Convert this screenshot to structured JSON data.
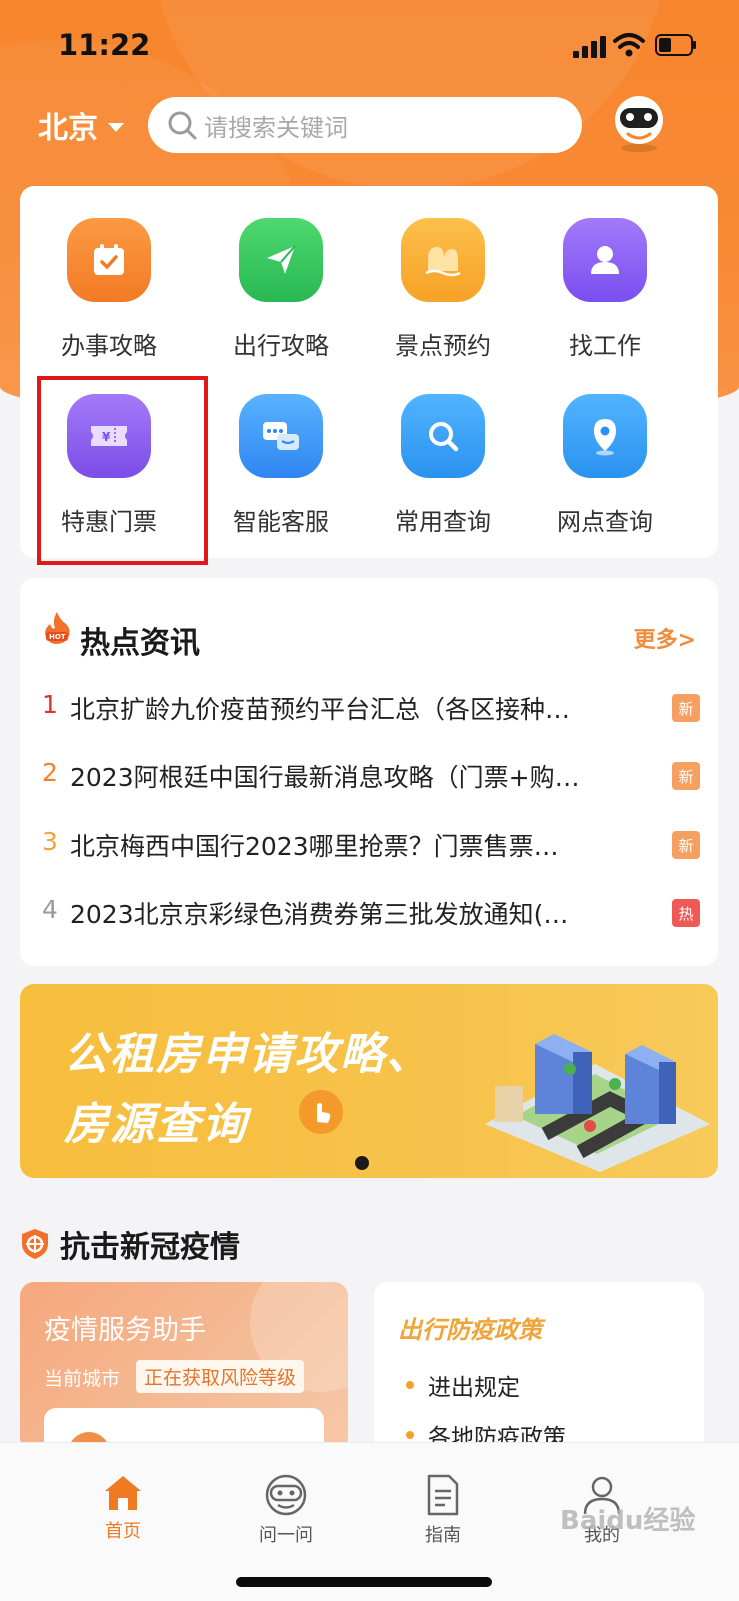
{
  "status_bar": {
    "time": "11:22"
  },
  "header": {
    "city": "北京",
    "search_placeholder": "请搜索关键词",
    "icons": {
      "search": "search-icon",
      "assistant": "robot-avatar-icon"
    }
  },
  "services": [
    {
      "label": "办事攻略",
      "icon": "calendar-check-icon",
      "color": "#f7862d"
    },
    {
      "label": "出行攻略",
      "icon": "paper-plane-icon",
      "color": "#31c45c"
    },
    {
      "label": "景点预约",
      "icon": "mountain-icon",
      "color": "#f9a92b"
    },
    {
      "label": "找工作",
      "icon": "person-icon",
      "color": "#8b5cf6"
    },
    {
      "label": "特惠门票",
      "icon": "ticket-yuan-icon",
      "color": "#8b57f0"
    },
    {
      "label": "智能客服",
      "icon": "chat-bubbles-icon",
      "color": "#3b92f5"
    },
    {
      "label": "常用查询",
      "icon": "magnifier-icon",
      "color": "#2f9cf2"
    },
    {
      "label": "网点查询",
      "icon": "location-pin-icon",
      "color": "#2f9cf2"
    }
  ],
  "news": {
    "title": "热点资讯",
    "more": "更多>",
    "items": [
      {
        "rank": "1",
        "rank_color": "#e0322a",
        "text": "北京扩龄九价疫苗预约平台汇总（各区接种…",
        "badge": "新",
        "badge_color": "#f5a060"
      },
      {
        "rank": "2",
        "rank_color": "#f0822a",
        "text": "2023阿根廷中国行最新消息攻略（门票+购…",
        "badge": "新",
        "badge_color": "#f5a060"
      },
      {
        "rank": "3",
        "rank_color": "#f2a33c",
        "text": "北京梅西中国行2023哪里抢票？门票售票…",
        "badge": "新",
        "badge_color": "#f5a060"
      },
      {
        "rank": "4",
        "rank_color": "#9a9a9a",
        "text": "2023北京京彩绿色消费券第三批发放通知(…",
        "badge": "热",
        "badge_color": "#ef5a56"
      }
    ]
  },
  "banner": {
    "line1": "公租房申请攻略、",
    "line2": "房源查询"
  },
  "covid": {
    "section_title": "抗击新冠疫情",
    "assistant_title": "疫情服务助手",
    "current_city_label": "当前城市",
    "risk_status": "正在获取风险等级",
    "policy_title": "出行防疫政策",
    "policy_items": [
      "进出规定",
      "各地防疫政策"
    ]
  },
  "tabbar": {
    "tabs": [
      {
        "label": "首页",
        "icon": "home-icon",
        "active": true
      },
      {
        "label": "问一问",
        "icon": "robot-icon",
        "active": false
      },
      {
        "label": "指南",
        "icon": "document-icon",
        "active": false
      },
      {
        "label": "我的",
        "icon": "user-icon",
        "active": false
      }
    ]
  },
  "colors": {
    "brand_orange": "#f7852d",
    "highlight_red": "#e01818"
  },
  "watermark": "Baidu经验"
}
